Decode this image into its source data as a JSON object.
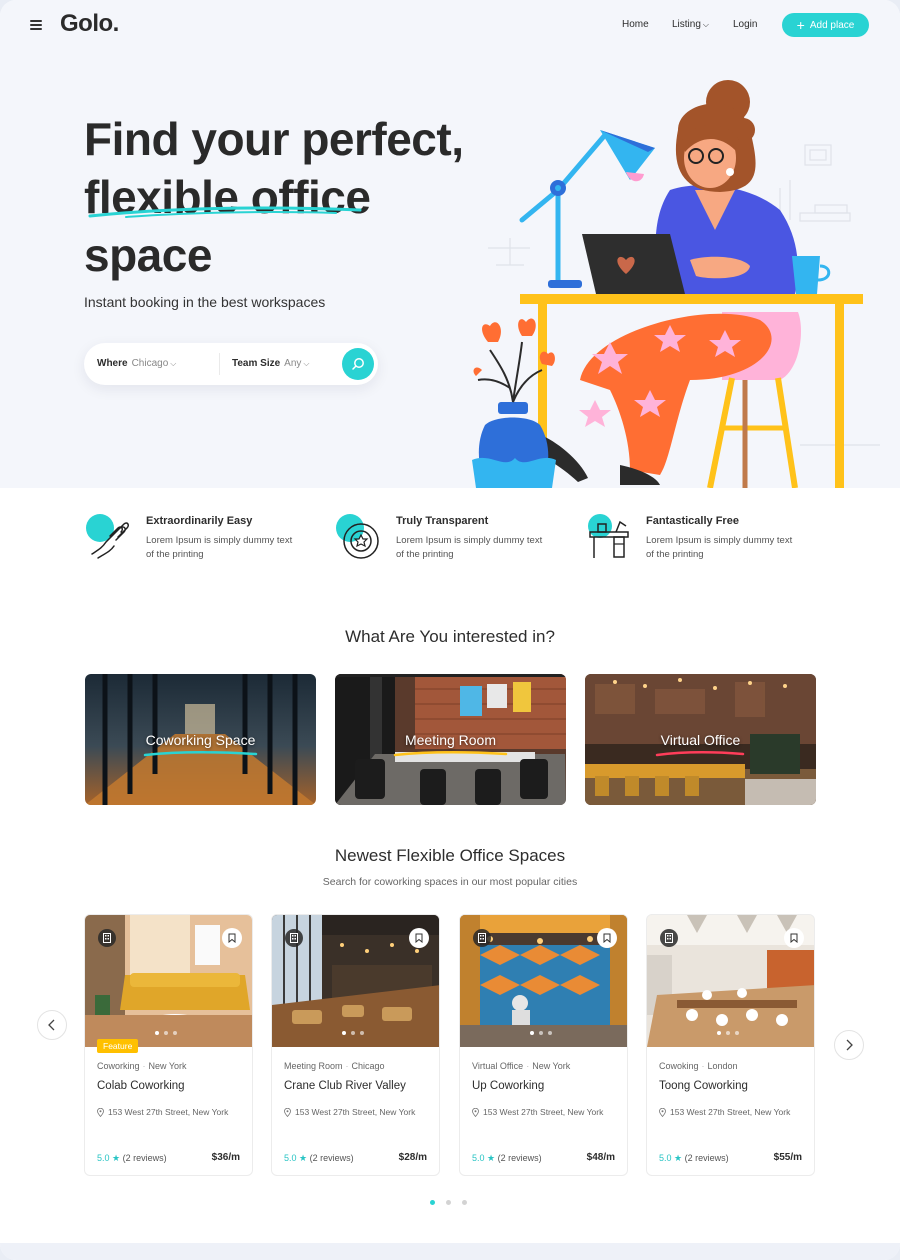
{
  "header": {
    "logo": "Golo.",
    "nav": {
      "home": "Home",
      "listing": "Listing",
      "login": "Login"
    },
    "add_place": "Add place"
  },
  "hero": {
    "title_line1": "Find your perfect,",
    "title_line2": "flexible office",
    "title_line3": "space",
    "subtitle": "Instant booking in the best workspaces",
    "search": {
      "where_label": "Where",
      "where_value": "Chicago",
      "team_label": "Team Size",
      "team_value": "Any"
    }
  },
  "features": [
    {
      "title": "Extraordinarily Easy",
      "desc": "Lorem Ipsum is simply dummy text of the printing"
    },
    {
      "title": "Truly Transparent",
      "desc": "Lorem Ipsum is simply dummy text of the printing"
    },
    {
      "title": "Fantastically Free",
      "desc": "Lorem Ipsum is simply dummy text of the printing"
    }
  ],
  "interests": {
    "title": "What Are You interested in?",
    "categories": [
      {
        "label": "Coworking Space"
      },
      {
        "label": "Meeting Room"
      },
      {
        "label": "Virtual Office"
      }
    ]
  },
  "newest": {
    "title": "Newest Flexible Office Spaces",
    "subtitle": "Search for coworking spaces in our most popular cities",
    "listings": [
      {
        "category": "Coworking",
        "city": "New York",
        "name": "Colab Coworking",
        "address": "153 West 27th Street, New York",
        "score": "5.0 ★",
        "reviews": "(2 reviews)",
        "price": "$36/m",
        "badge": "Feature"
      },
      {
        "category": "Meeting Room",
        "city": "Chicago",
        "name": "Crane Club River Valley",
        "address": "153 West 27th Street, New York",
        "score": "5.0 ★",
        "reviews": "(2 reviews)",
        "price": "$28/m"
      },
      {
        "category": "Virtual Office",
        "city": "New York",
        "name": "Up Coworking",
        "address": "153 West 27th Street, New York",
        "score": "5.0 ★",
        "reviews": "(2 reviews)",
        "price": "$48/m"
      },
      {
        "category": "Cowoking",
        "city": "London",
        "name": "Toong Coworking",
        "address": "153 West 27th Street, New York",
        "score": "5.0 ★",
        "reviews": "(2 reviews)",
        "price": "$55/m"
      }
    ]
  },
  "colors": {
    "accent": "#29d3d3",
    "badge": "#ffc000",
    "text": "#2d2d2d"
  }
}
